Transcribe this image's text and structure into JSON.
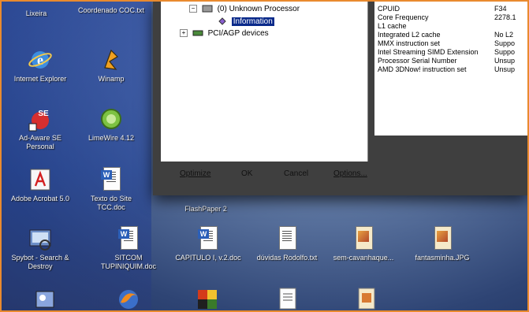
{
  "window": {
    "tree": {
      "processor_label": "(0) Unknown Processor",
      "information_label": "Information",
      "pci_label": "PCI/AGP devices"
    },
    "properties": [
      {
        "name": "CPUID",
        "value": "F34"
      },
      {
        "name": "Core Frequency",
        "value": "2278.1"
      },
      {
        "name": "L1 cache",
        "value": ""
      },
      {
        "name": "Integrated L2 cache",
        "value": "No L2"
      },
      {
        "name": "MMX instruction set",
        "value": "Suppo"
      },
      {
        "name": "Intel Streaming SIMD Extension",
        "value": "Suppo"
      },
      {
        "name": "Processor Serial Number",
        "value": "Unsup"
      },
      {
        "name": "AMD 3DNow! instruction set",
        "value": "Unsup"
      }
    ],
    "buttons": {
      "optimize": "Optimize",
      "ok": "OK",
      "cancel": "Cancel",
      "options": "Options..."
    }
  },
  "desktop_icons": {
    "lixeira": "Lixeira",
    "coordenado": "Coordenado COC.txt",
    "internet_explorer": "Internet Explorer",
    "winamp": "Winamp",
    "adaware": "Ad-Aware SE Personal",
    "limewire": "LimeWire 4.12",
    "acrobat": "Adobe Acrobat 5.0",
    "texto_site": "Texto do Site TCC.doc",
    "flashpaper": "FlashPaper 2",
    "spybot": "Spybot - Search & Destroy",
    "sitcom": "SITCOM TUPINIQUIM.doc",
    "capitulo": "CAPITULO I, v.2.doc",
    "duvidas": "dúvidas Rodolfo.txt",
    "sem_cavanhaque": "sem-cavanhaque...",
    "fantasminha": "fantasminha.JPG"
  }
}
